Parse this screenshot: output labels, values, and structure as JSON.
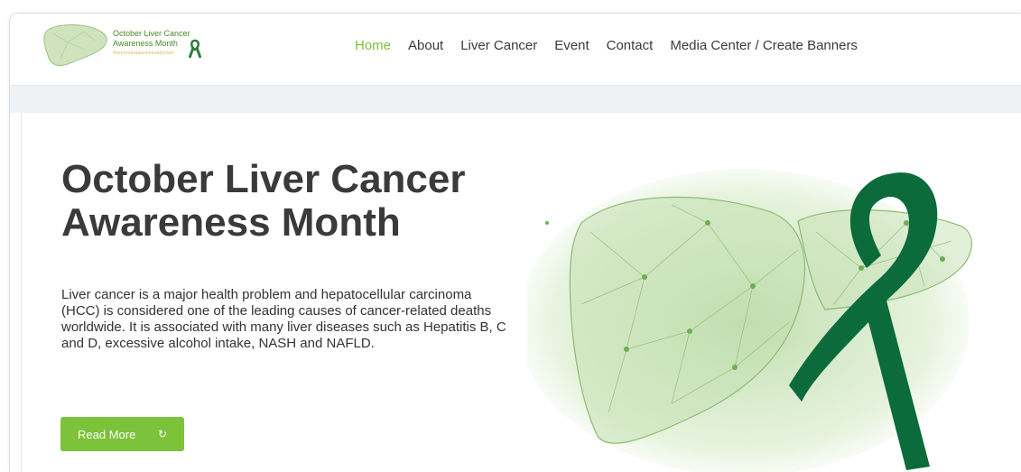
{
  "logo": {
    "line1": "October Liver Cancer",
    "line2": "Awareness Month",
    "line3": "#liveryourawarenessbyliver"
  },
  "nav": {
    "items": [
      {
        "label": "Home",
        "active": true
      },
      {
        "label": "About",
        "active": false
      },
      {
        "label": "Liver Cancer",
        "active": false
      },
      {
        "label": "Event",
        "active": false
      },
      {
        "label": "Contact",
        "active": false
      },
      {
        "label": "Media Center / Create Banners",
        "active": false
      }
    ]
  },
  "hero": {
    "title_line1": "October Liver Cancer",
    "title_line2": "Awareness Month",
    "description": "Liver cancer is a major health problem and hepatocellular carcinoma (HCC) is considered one of the leading causes of cancer-related deaths worldwide. It is associated with many liver diseases such as Hepatitis B, C and D, excessive alcohol intake, NASH and NAFLD.",
    "button_label": "Read More",
    "button_icon": "refresh-icon"
  },
  "colors": {
    "accent": "#7cc23a",
    "ribbon": "#0b6b3a",
    "text": "#3a3a3a"
  }
}
